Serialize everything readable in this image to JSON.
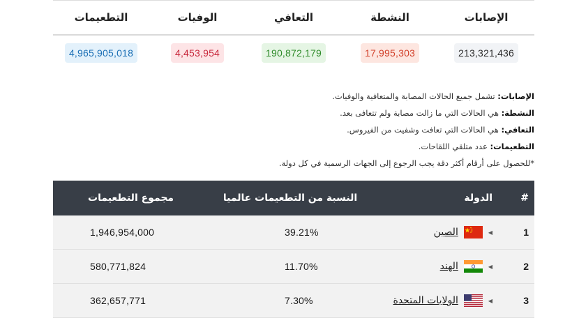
{
  "stats": {
    "headers": [
      "الإصابات",
      "النشطة",
      "التعافي",
      "الوفيات",
      "التطعيمات"
    ],
    "values": {
      "cases": "213,321,436",
      "active": "17,995,303",
      "recovered": "190,872,179",
      "deaths": "4,453,954",
      "vaccinations": "4,965,905,018"
    }
  },
  "definitions": [
    {
      "term": "الإصابات:",
      "text": " تشمل جميع الحالات المصابة والمتعافية والوفيات."
    },
    {
      "term": "النشطة:",
      "text": " هي الحالات التي ما زالت مصابة ولم تتعافى بعد."
    },
    {
      "term": "التعافي:",
      "text": " هي الحالات التي تعافت وشفيت من الفيروس."
    },
    {
      "term": "التطعيمات:",
      "text": " عدد متلقي اللقاحات."
    }
  ],
  "note": "*للحصول على أرقام أكثر دقة يجب الرجوع إلى الجهات الرسمية في كل دولة.",
  "table": {
    "headers": {
      "num": "#",
      "country": "الدولة",
      "percent": "النسبة من التطعيمات عالميا",
      "total": "مجموع التطعيمات"
    },
    "rows": [
      {
        "num": "1",
        "country": "الصين",
        "percent": "39.21%",
        "total": "1,946,954,000",
        "flag": "china"
      },
      {
        "num": "2",
        "country": "الهند",
        "percent": "11.70%",
        "total": "580,771,824",
        "flag": "india"
      },
      {
        "num": "3",
        "country": "الولايات المتحدة",
        "percent": "7.30%",
        "total": "362,657,771",
        "flag": "usa"
      }
    ]
  },
  "colors": {
    "header_bg": "#383e47",
    "active": "#d2402a",
    "recovered": "#2e8b2a",
    "deaths": "#c8283c",
    "vaccinations": "#1b6fb5"
  }
}
